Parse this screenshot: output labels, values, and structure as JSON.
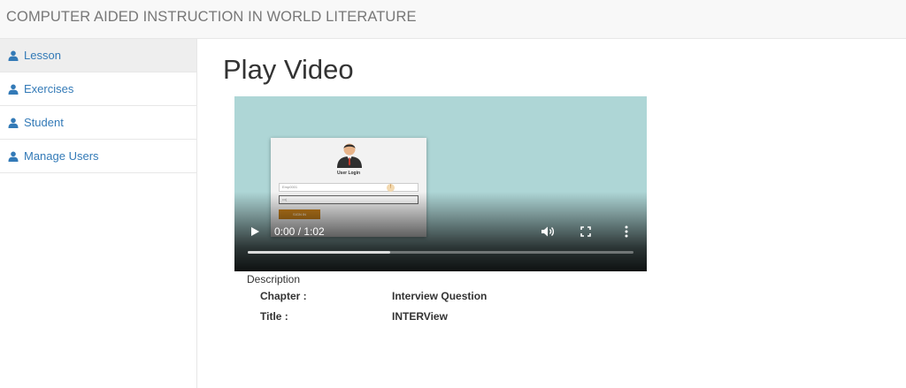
{
  "header": {
    "title": "COMPUTER AIDED INSTRUCTION IN WORLD LITERATURE"
  },
  "sidebar": {
    "items": [
      {
        "label": "Lesson",
        "icon": "user-icon",
        "active": true
      },
      {
        "label": "Exercises",
        "icon": "user-icon"
      },
      {
        "label": "Student",
        "icon": "user-icon"
      },
      {
        "label": "Manage Users",
        "icon": "user-icon"
      }
    ]
  },
  "main": {
    "title": "Play Video",
    "video": {
      "time": "0:00 / 1:02",
      "buffered_fraction": 0.37,
      "frame": {
        "login_title": "User Login",
        "username_value": "Emp0001",
        "password_value": "•••|",
        "button_label": "SIGN IN"
      }
    },
    "description": {
      "label": "Description",
      "chapter_key": "Chapter :",
      "chapter_value": "Interview Question",
      "title_key": "Title :",
      "title_value": "INTERView"
    }
  },
  "colors": {
    "link": "#337ab7",
    "video_bg": "#aed6d6",
    "header_bg": "#f8f8f8"
  }
}
